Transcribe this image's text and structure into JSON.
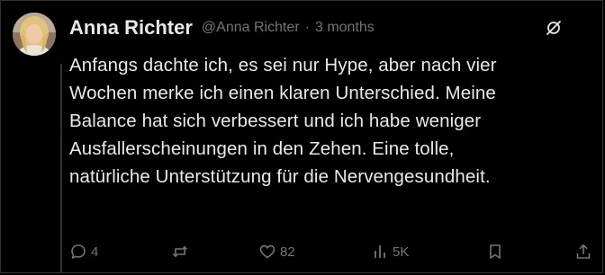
{
  "author": {
    "display_name": "Anna Richter",
    "handle": "@Anna Richter",
    "separator": "·",
    "time": "3 months"
  },
  "post": {
    "lines": [
      "Anfangs dachte ich, es sei nur Hype, aber nach vier",
      "Wochen merke ich einen klaren Unterschied. Meine",
      "Balance hat sich verbessert und ich habe weniger",
      "Ausfallerscheinungen in den Zehen. Eine tolle,",
      "natürliche Unterstützung für die Nervengesundheit."
    ]
  },
  "actions": {
    "replies": "4",
    "reposts": "",
    "likes": "82",
    "views": "5K"
  },
  "icons": {
    "avatar": "profile-photo",
    "grok": "grok-slash-icon",
    "reply": "reply-bubble-icon",
    "repost": "repost-arrows-icon",
    "like": "heart-icon",
    "views": "views-bar-chart-icon",
    "bookmark": "bookmark-icon",
    "share": "share-upload-icon"
  },
  "colors": {
    "background": "#000000",
    "text": "#e7e9ea",
    "muted": "#71767b",
    "border": "#2f3336"
  }
}
